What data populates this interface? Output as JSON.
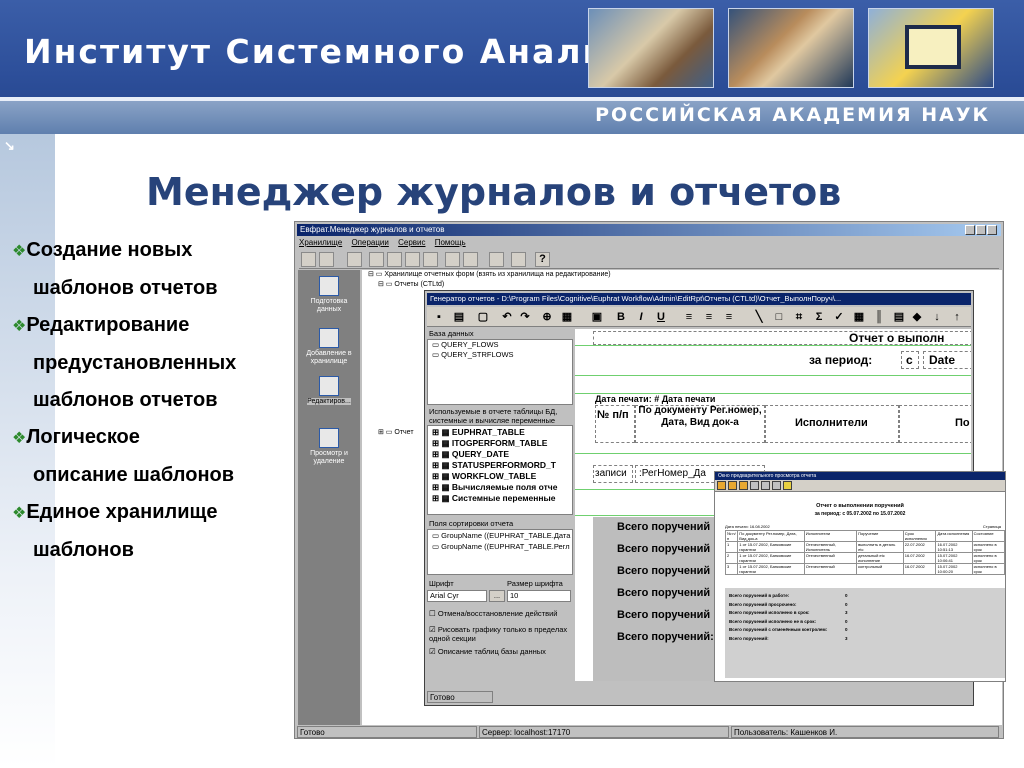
{
  "banner": {
    "institute": "Институт Системного Анализа",
    "academy": "РОССИЙСКАЯ АКАДЕМИЯ НАУК"
  },
  "slide": {
    "title": "Менеджер журналов и отчетов",
    "bullets": [
      {
        "line1": "Создание новых",
        "line2": "шаблонов отчетов"
      },
      {
        "line1": "Редактирование",
        "line2": "предустановленных",
        "line3": "шаблонов отчетов"
      },
      {
        "line1": "Логическое",
        "line2": "описание шаблонов"
      },
      {
        "line1": "Единое хранилище",
        "line2": "шаблонов"
      }
    ]
  },
  "app": {
    "title": "Евфрат.Менеджер журналов и отчетов",
    "menu": [
      "Хранилище",
      "Операции",
      "Сервис",
      "Помощь"
    ],
    "nav": [
      "Подготовка данных",
      "Добавление в хранилище",
      "Редактиров...",
      "Просмотр и удаление"
    ],
    "tree": {
      "root": "Хранилище отчетных форм (взять из хранилища на редактирование)",
      "reports1": "Отчеты (CTLtd)",
      "reports2": "Отчет"
    },
    "status": {
      "ready": "Готово",
      "server": "Сервер: localhost:17170",
      "user": "Пользователь: Кашенков И."
    }
  },
  "generator": {
    "title": "Генератор отчетов - D:\\Program Files\\Cognitive\\Euphrat Workflow\\Admin\\EditRpt\\Отчеты (CTLtd)\\Отчет_ВыполнПоруч\\...",
    "db_label": "База данных",
    "db_items": [
      "QUERY_FLOWS",
      "QUERY_STRFLOWS"
    ],
    "tables_label": "Используемые в отчете таблицы БД, системные и вычисляе переменные",
    "tables": [
      "EUPHRAT_TABLE",
      "ITOGPERFORM_TABLE",
      "QUERY_DATE",
      "STATUSPERFORMORD_T",
      "WORKFLOW_TABLE",
      "Вычисляемые поля отче",
      "Системные переменные"
    ],
    "sort_label": "Поля сортировки отчета",
    "sort_items": [
      "GroupName ((EUPHRAT_TABLE.Дата",
      "GroupName ((EUPHRAT_TABLE.Регл"
    ],
    "font_label": "Шрифт",
    "font_size_label": "Размер шрифта",
    "font_value": "Arial Cyr",
    "font_size_value": "10",
    "browse": "...",
    "options": [
      "Отмена/восстановление действий",
      "Рисовать графику только в пределах одной секции",
      "Описание таблиц базы данных"
    ],
    "status": "Готово",
    "canvas": {
      "report_title": "Отчет о выполн",
      "period": "за период:",
      "from": "с",
      "date_field": "Date",
      "print_date": "Дата печати: # Дата печати",
      "col_num": "№ п/п",
      "col_doc": "По документу Рег.номер, Дата, Вид док-а",
      "col_exec": "Исполнители",
      "col_cut": "По",
      "row_field1": "записи",
      "row_field2": ":РегНомер_Да",
      "totals": [
        "Всего поручений",
        "Всего поручений",
        "Всего поручений",
        "Всего поручений",
        "Всего поручений",
        "Всего поручений:"
      ]
    }
  },
  "preview": {
    "title": "Окно предварительного просмотра отчета",
    "report_title": "Отчет о выполнении поручений",
    "period": "за период:   с   05.07.2002        по   15.07.2002",
    "print_date": "Дата печати: 16.08.2002",
    "page": "Страница",
    "headers": [
      "№ п/п",
      "По документу Рег.номер, Дата, Вид док-а",
      "Исполнители",
      "Поручение",
      "Срок исполнения",
      "Дата исполнения",
      "Состояние"
    ],
    "rows": [
      [
        "1",
        "1 от 15.07.2002, Банковские гарантии",
        "Отечественный, Исполнитель",
        "выполнить в деталь etc",
        "22.07.2002",
        "16.07.2002 10:51:13",
        "исполнено в срок"
      ],
      [
        "2",
        "1 от 15.07.2002, Банковские гарантии",
        "Отечественный",
        "детальный etc исполнение",
        "16.07.2002",
        "15.07.2002 10:06:41",
        "исполнено в срок"
      ],
      [
        "3",
        "1 от 15.07.2002, Банковские гарантии",
        "Отечественный",
        "контрольный",
        "16.07.2002",
        "15.07.2002 10:00:20",
        "исполнено в срок"
      ]
    ],
    "totals": [
      {
        "label": "Всего поручений в работе:",
        "value": "0"
      },
      {
        "label": "Всего поручений просрочено:",
        "value": "0"
      },
      {
        "label": "Всего поручений исполнено в срок:",
        "value": "3"
      },
      {
        "label": "Всего поручений исполнено не в срок:",
        "value": "0"
      },
      {
        "label": "Всего поручений с отменённым контролем:",
        "value": "0"
      },
      {
        "label": "Всего поручений:",
        "value": "3"
      }
    ]
  },
  "colors": {
    "banner": "#2d4f9a",
    "title": "#27437a",
    "bullet_marker": "#2d8a2d",
    "gridline": "#6fd06f"
  }
}
